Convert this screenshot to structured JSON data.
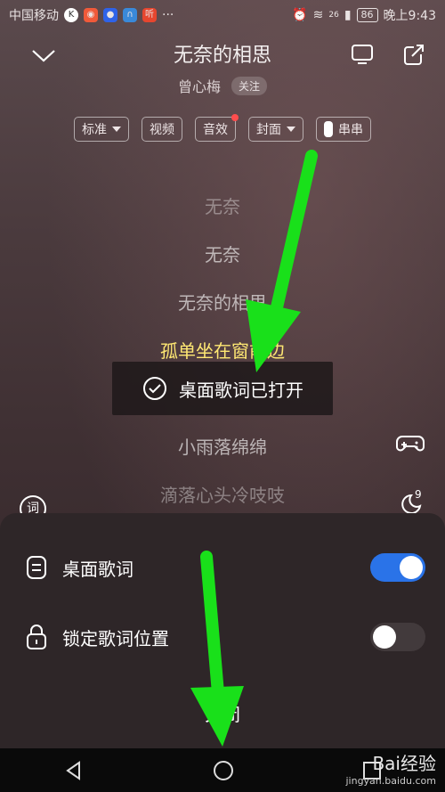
{
  "statusbar": {
    "carrier": "中国移动",
    "battery": "86",
    "time": "晚上9:43",
    "signal": "26",
    "app4": "听"
  },
  "header": {
    "title": "无奈的相思",
    "artist": "曾心梅",
    "follow": "关注"
  },
  "chips": [
    {
      "label": "标准",
      "caret": true
    },
    {
      "label": "视频"
    },
    {
      "label": "音效",
      "badge": true
    },
    {
      "label": "封面",
      "caret": true
    },
    {
      "label": "串串",
      "toggle": true
    }
  ],
  "lyrics": [
    {
      "text": "无奈",
      "state": "dim"
    },
    {
      "text": "无奈",
      "state": "normal"
    },
    {
      "text": "无奈的相思",
      "state": "normal"
    },
    {
      "text": "孤单坐在窗前边",
      "state": "active"
    },
    {
      "text": "",
      "state": "hidden"
    },
    {
      "text": "小雨落绵绵",
      "state": "normal"
    },
    {
      "text": "滴落心头冷吱吱",
      "state": "dim"
    }
  ],
  "toast": {
    "text": "桌面歌词已打开"
  },
  "side": {
    "left_label": "词",
    "right_label": "9"
  },
  "sheet": {
    "desktop_lyrics": {
      "label": "桌面歌词",
      "on": true
    },
    "lock_position": {
      "label": "锁定歌词位置",
      "on": false
    },
    "close": "关闭"
  },
  "watermark": {
    "brand": "Bai经验",
    "url": "jingyan.baidu.com"
  },
  "colors": {
    "accent": "#2a73e8",
    "lyric_active": "#ffe873",
    "arrow": "#19e01a"
  }
}
